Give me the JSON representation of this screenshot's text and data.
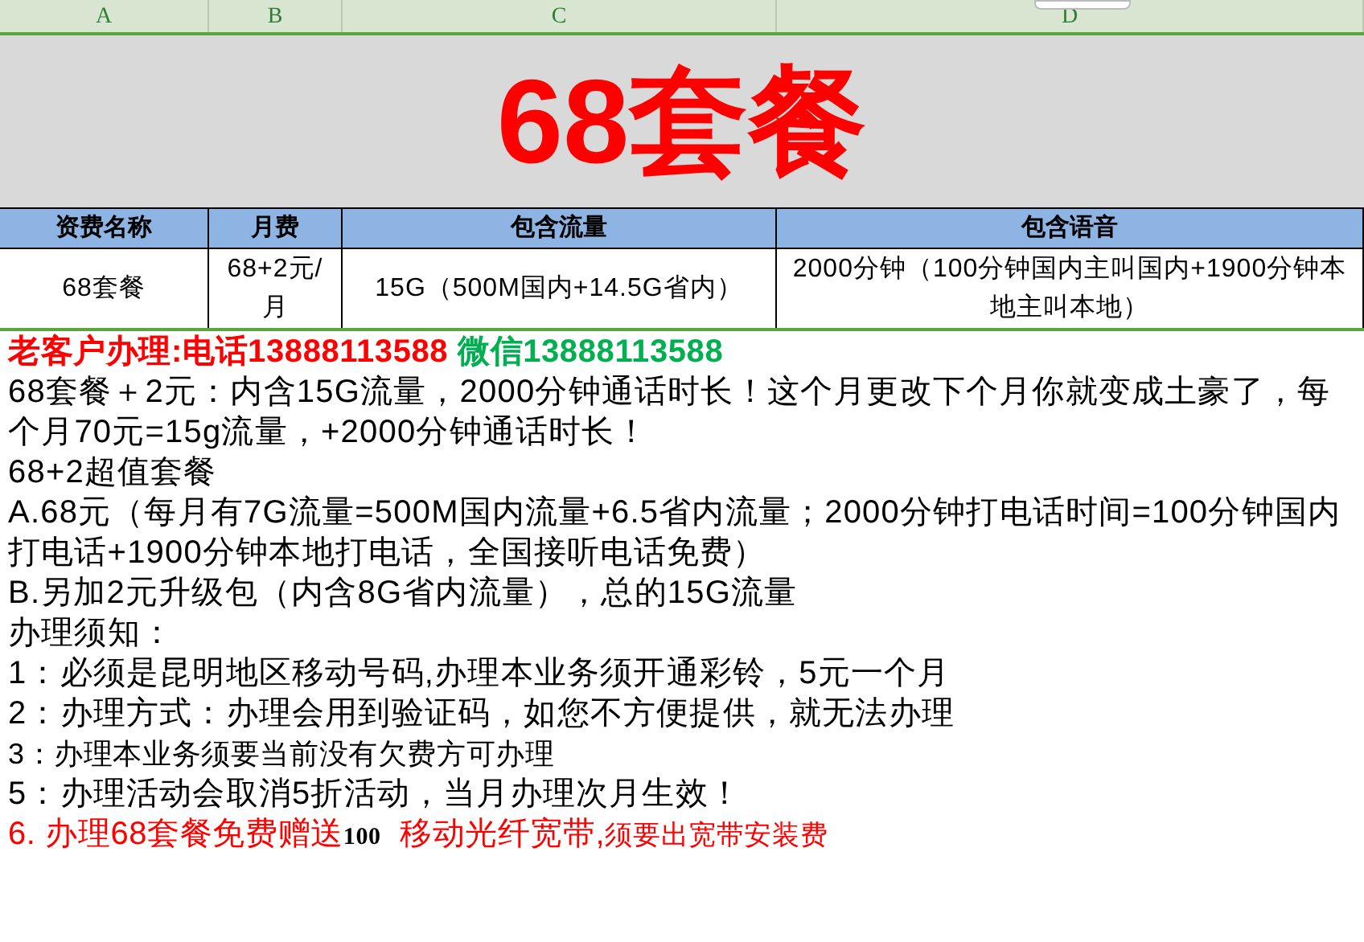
{
  "columns": [
    "A",
    "B",
    "C",
    "D"
  ],
  "title": "68套餐",
  "table": {
    "headers": [
      "资费名称",
      "月费",
      "包含流量",
      "包含语音"
    ],
    "rows": [
      [
        "68套餐",
        "68+2元/月",
        "15G（500M国内+14.5G省内）",
        "2000分钟（100分钟国内主叫国内+1900分钟本地主叫本地）"
      ]
    ]
  },
  "lines": [
    {
      "kind": "segments",
      "segments": [
        {
          "text": "老客户办理:电话13888113588",
          "color": "#ff0000",
          "bold": true,
          "kind": "normal"
        },
        {
          "text": " 微信13888113588",
          "color": "#00b050",
          "bold": true,
          "kind": "normal"
        }
      ]
    },
    {
      "kind": "text",
      "text": "68套餐＋2元：内含15G流量，2000分钟通话时长！这个月更改下个月你就变成土豪了，每个月70元=15g流量，+2000分钟通话时长！"
    },
    {
      "kind": "text",
      "text": "68+2超值套餐"
    },
    {
      "kind": "text",
      "text": "A.68元（每月有7G流量=500M国内流量+6.5省内流量；2000分钟打电话时间=100分钟国内打电话+1900分钟本地打电话，全国接听电话免费）"
    },
    {
      "kind": "text",
      "text": "B.另加2元升级包（内含8G省内流量），总的15G流量"
    },
    {
      "kind": "text",
      "text": "办理须知："
    },
    {
      "kind": "text",
      "text": "1：必须是昆明地区移动号码,办理本业务须开通彩铃，5元一个月"
    },
    {
      "kind": "text",
      "text": "2：办理方式：办理会用到验证码，如您不方便提供，就无法办理"
    },
    {
      "kind": "small",
      "text": "3：办理本业务须要当前没有欠费方可办理"
    },
    {
      "kind": "text",
      "text": "5：办理活动会取消5折活动，当月办理次月生效！"
    },
    {
      "kind": "segments",
      "segments": [
        {
          "text": "6. 办理68套餐免费赠送",
          "color": "#ff0000",
          "bold": false,
          "kind": "normal"
        },
        {
          "text": "100",
          "color": "#000000",
          "bold": true,
          "kind": "serif"
        },
        {
          "text": "  移动光纤宽带,",
          "color": "#ff0000",
          "bold": false,
          "kind": "normal"
        },
        {
          "text": "须要出宽带安装费",
          "color": "#ff0000",
          "bold": false,
          "kind": "small"
        }
      ]
    }
  ]
}
